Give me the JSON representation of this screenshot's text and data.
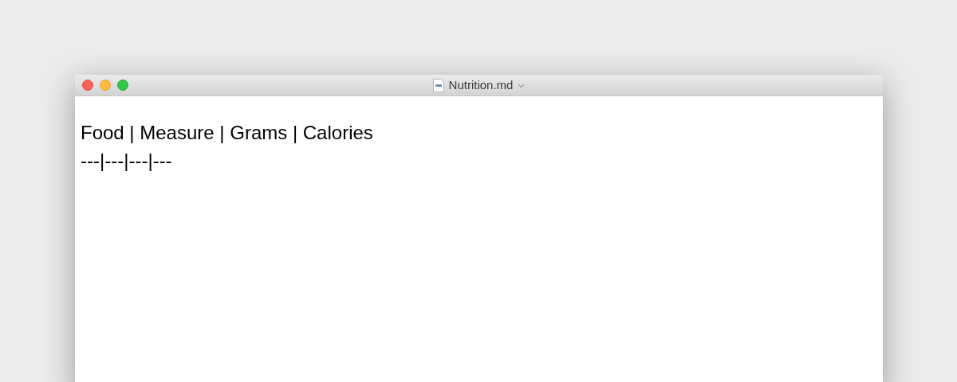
{
  "window": {
    "title": "Nutrition.md"
  },
  "editor": {
    "lines": [
      "Food | Measure | Grams | Calories",
      "---|---|---|---"
    ]
  }
}
